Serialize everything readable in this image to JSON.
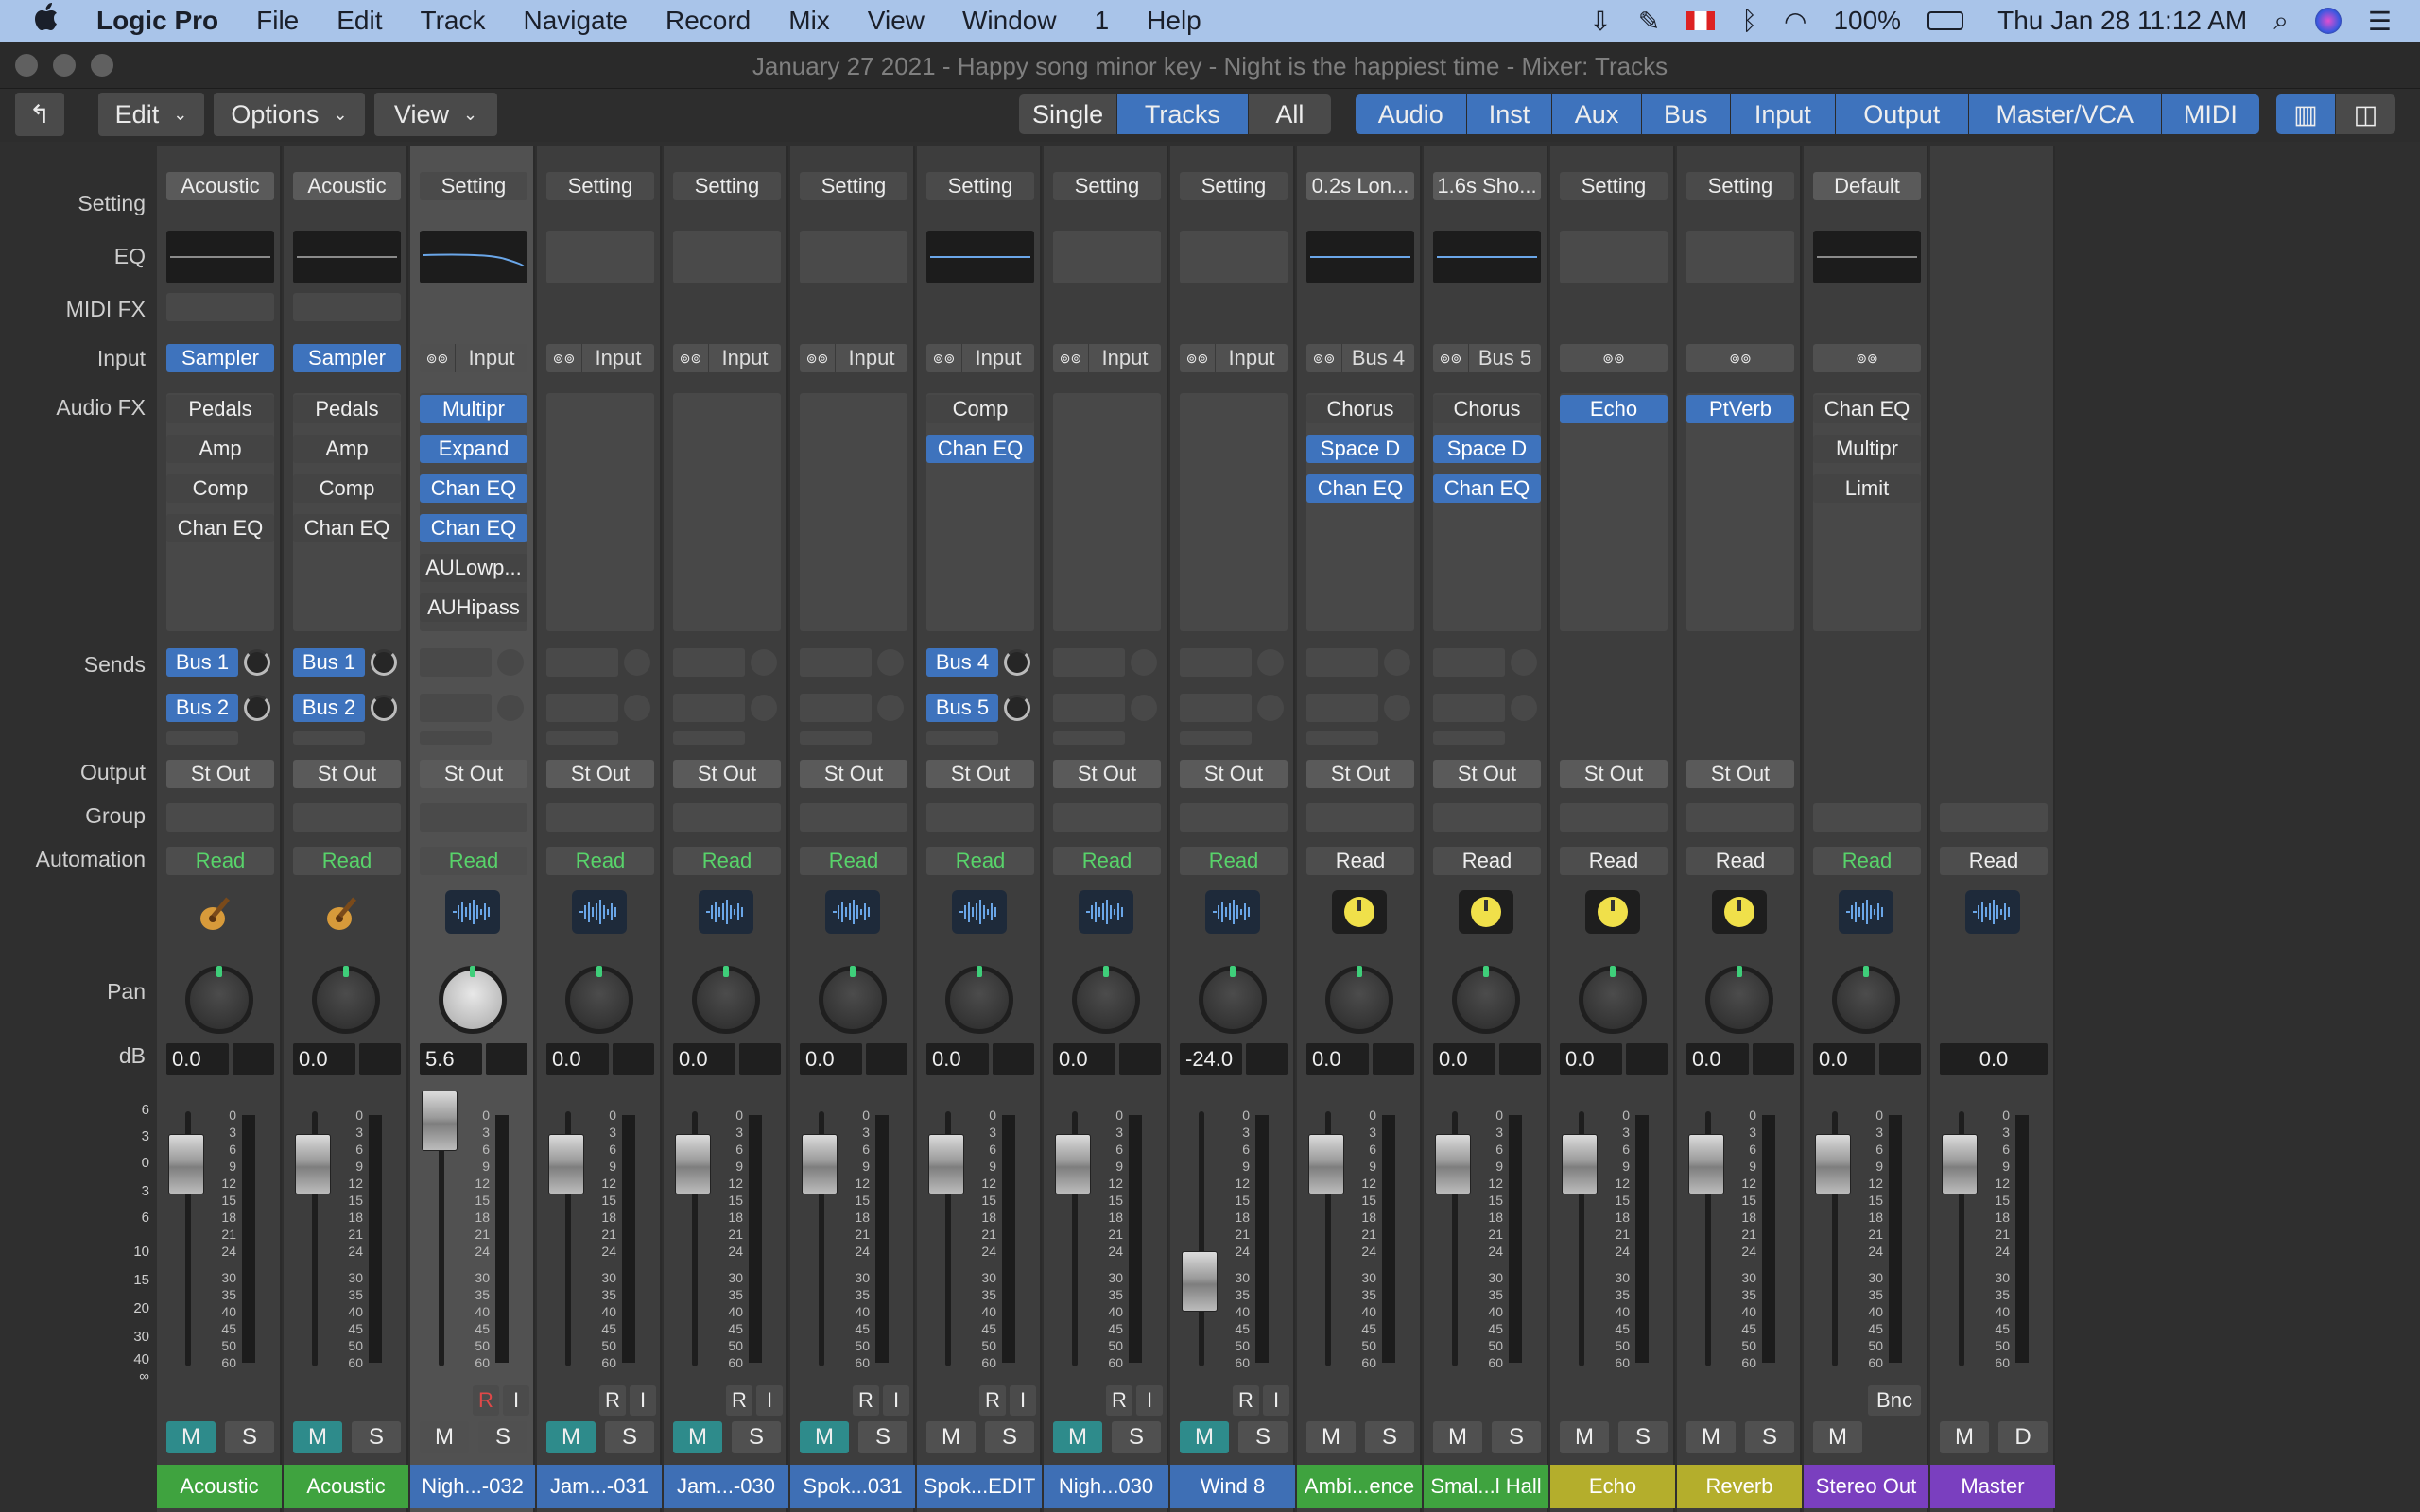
{
  "menubar": {
    "app": "Logic Pro",
    "items": [
      "File",
      "Edit",
      "Track",
      "Navigate",
      "Record",
      "Mix",
      "View",
      "Window",
      "1",
      "Help"
    ],
    "battery": "100%",
    "clock": "Thu Jan 28  11:12 AM"
  },
  "window": {
    "title": "January 27 2021 - Happy song minor key - Night is the happiest time - Mixer: Tracks"
  },
  "toolbar": {
    "edit": "Edit",
    "options": "Options",
    "view": "View",
    "filters": [
      "Single",
      "Tracks",
      "All"
    ],
    "filter_active": "Tracks",
    "types": [
      "Audio",
      "Inst",
      "Aux",
      "Bus",
      "Input",
      "Output",
      "Master/VCA",
      "MIDI"
    ]
  },
  "row_labels": {
    "setting": "Setting",
    "eq": "EQ",
    "midi_fx": "MIDI FX",
    "input": "Input",
    "audio_fx": "Audio FX",
    "sends": "Sends",
    "output": "Output",
    "group": "Group",
    "automation": "Automation",
    "pan": "Pan",
    "db": "dB"
  },
  "db_scale_left": [
    "6",
    "3",
    "0",
    "3",
    "6",
    "10",
    "15",
    "20",
    "30",
    "40",
    "∞"
  ],
  "db_scale_meter": [
    "0",
    "3",
    "6",
    "9",
    "12",
    "15",
    "18",
    "21",
    "24",
    "30",
    "35",
    "40",
    "45",
    "50",
    "60"
  ],
  "strips": [
    {
      "name": "Acoustic",
      "setting": "Acoustic",
      "input": "Sampler",
      "input_type": "inst",
      "fx": [
        "Pedals",
        "Amp",
        "Comp",
        "Chan EQ"
      ],
      "fx_on": [
        false,
        false,
        false,
        false
      ],
      "sends": [
        "Bus 1",
        "Bus 2"
      ],
      "output": "St Out",
      "auto": "Read",
      "auto_green": true,
      "icon": "guitar-icon",
      "db": "0.0",
      "mute": "M",
      "solo": "S",
      "mute_on": true,
      "color": "#3fa33f",
      "eq": "flat",
      "midifx": true
    },
    {
      "name": "Acoustic",
      "setting": "Acoustic",
      "input": "Sampler",
      "input_type": "inst",
      "fx": [
        "Pedals",
        "Amp",
        "Comp",
        "Chan EQ"
      ],
      "fx_on": [
        false,
        false,
        false,
        false
      ],
      "sends": [
        "Bus 1",
        "Bus 2"
      ],
      "output": "St Out",
      "auto": "Read",
      "auto_green": true,
      "icon": "guitar-icon",
      "db": "0.0",
      "mute": "M",
      "solo": "S",
      "mute_on": true,
      "color": "#3fa33f",
      "eq": "flat",
      "midifx": true
    },
    {
      "name": "Nigh...-032",
      "setting": "Setting",
      "input": "Input",
      "input_type": "audio",
      "fx": [
        "Multipr",
        "Expand",
        "Chan EQ",
        "Chan EQ",
        "AULowp...",
        "AUHipass"
      ],
      "fx_on": [
        true,
        true,
        true,
        true,
        false,
        false
      ],
      "sends": [],
      "output": "St Out",
      "auto": "Read",
      "auto_green": true,
      "icon": "waveform-icon",
      "db": "5.6",
      "mute": "M",
      "solo": "S",
      "mute_on": false,
      "color": "#3e6fb5",
      "eq": "curve",
      "selected": true,
      "rec": "R",
      "inmon": "I",
      "rec_red": true
    },
    {
      "name": "Jam...-031",
      "setting": "Setting",
      "input": "Input",
      "input_type": "audio",
      "fx": [],
      "fx_on": [],
      "sends": [],
      "output": "St Out",
      "auto": "Read",
      "auto_green": true,
      "icon": "waveform-icon",
      "db": "0.0",
      "mute": "M",
      "solo": "S",
      "mute_on": true,
      "color": "#3e6fb5",
      "eq": "none",
      "rec": "R",
      "inmon": "I"
    },
    {
      "name": "Jam...-030",
      "setting": "Setting",
      "input": "Input",
      "input_type": "audio",
      "fx": [],
      "fx_on": [],
      "sends": [],
      "output": "St Out",
      "auto": "Read",
      "auto_green": true,
      "icon": "waveform-icon",
      "db": "0.0",
      "mute": "M",
      "solo": "S",
      "mute_on": true,
      "color": "#3e6fb5",
      "eq": "none",
      "rec": "R",
      "inmon": "I"
    },
    {
      "name": "Spok...031",
      "setting": "Setting",
      "input": "Input",
      "input_type": "audio",
      "fx": [],
      "fx_on": [],
      "sends": [],
      "output": "St Out",
      "auto": "Read",
      "auto_green": true,
      "icon": "waveform-icon",
      "db": "0.0",
      "mute": "M",
      "solo": "S",
      "mute_on": true,
      "color": "#3e6fb5",
      "eq": "none",
      "rec": "R",
      "inmon": "I"
    },
    {
      "name": "Spok...EDIT",
      "setting": "Setting",
      "input": "Input",
      "input_type": "audio",
      "fx": [
        "Comp",
        "Chan EQ"
      ],
      "fx_on": [
        false,
        true
      ],
      "sends": [
        "Bus 4",
        "Bus 5"
      ],
      "output": "St Out",
      "auto": "Read",
      "auto_green": true,
      "icon": "waveform-icon",
      "db": "0.0",
      "mute": "M",
      "solo": "S",
      "mute_on": false,
      "color": "#3e6fb5",
      "eq": "line",
      "rec": "R",
      "inmon": "I"
    },
    {
      "name": "Nigh...030",
      "setting": "Setting",
      "input": "Input",
      "input_type": "audio",
      "fx": [],
      "fx_on": [],
      "sends": [],
      "output": "St Out",
      "auto": "Read",
      "auto_green": true,
      "icon": "waveform-icon",
      "db": "0.0",
      "mute": "M",
      "solo": "S",
      "mute_on": true,
      "color": "#3e6fb5",
      "eq": "none",
      "rec": "R",
      "inmon": "I"
    },
    {
      "name": "Wind 8",
      "setting": "Setting",
      "input": "Input",
      "input_type": "audio",
      "fx": [],
      "fx_on": [],
      "sends": [],
      "output": "St Out",
      "auto": "Read",
      "auto_green": true,
      "icon": "waveform-icon",
      "db": "-24.0",
      "mute": "M",
      "solo": "S",
      "mute_on": true,
      "color": "#3e6fb5",
      "eq": "none",
      "rec": "R",
      "inmon": "I"
    },
    {
      "name": "Ambi...ence",
      "setting": "0.2s Lon...",
      "input": "Bus 4",
      "input_type": "aux",
      "fx": [
        "Chorus",
        "Space D",
        "Chan EQ"
      ],
      "fx_on": [
        false,
        true,
        true
      ],
      "sends": [],
      "output": "St Out",
      "auto": "Read",
      "auto_green": false,
      "icon": "aux-knob-icon",
      "db": "0.0",
      "mute": "M",
      "solo": "S",
      "mute_on": false,
      "color": "#3fa33f",
      "eq": "line"
    },
    {
      "name": "Smal...l Hall",
      "setting": "1.6s Sho...",
      "input": "Bus 5",
      "input_type": "aux",
      "fx": [
        "Chorus",
        "Space D",
        "Chan EQ"
      ],
      "fx_on": [
        false,
        true,
        true
      ],
      "sends": [],
      "output": "St Out",
      "auto": "Read",
      "auto_green": false,
      "icon": "aux-knob-icon",
      "db": "0.0",
      "mute": "M",
      "solo": "S",
      "mute_on": false,
      "color": "#3fa33f",
      "eq": "line"
    },
    {
      "name": "Echo",
      "setting": "Setting",
      "input": "",
      "input_type": "aux",
      "fx": [
        "Echo"
      ],
      "fx_on": [
        true
      ],
      "sends": [],
      "nosends": true,
      "output": "St Out",
      "auto": "Read",
      "auto_green": false,
      "icon": "aux-knob-icon",
      "db": "0.0",
      "mute": "M",
      "solo": "S",
      "mute_on": false,
      "color": "#b4ae2c",
      "eq": "none"
    },
    {
      "name": "Reverb",
      "setting": "Setting",
      "input": "",
      "input_type": "aux",
      "fx": [
        "PtVerb"
      ],
      "fx_on": [
        true
      ],
      "sends": [],
      "nosends": true,
      "output": "St Out",
      "auto": "Read",
      "auto_green": false,
      "icon": "aux-knob-icon",
      "db": "0.0",
      "mute": "M",
      "solo": "S",
      "mute_on": false,
      "color": "#b4ae2c",
      "eq": "none"
    },
    {
      "name": "Stereo Out",
      "setting": "Default",
      "input": "",
      "input_type": "aux",
      "fx": [
        "Chan EQ",
        "Multipr",
        "Limit"
      ],
      "fx_on": [
        false,
        false,
        false
      ],
      "sends": [],
      "nosends": true,
      "output": "",
      "auto": "Read",
      "auto_green": true,
      "icon": "waveform-icon",
      "db": "0.0",
      "mute": "M",
      "solo": "",
      "bnc": "Bnc",
      "mute_on": false,
      "color": "#7a3fbf",
      "eq": "flat"
    },
    {
      "name": "Master",
      "setting": "",
      "input": "",
      "input_type": "none",
      "fx": [],
      "fx_on": [],
      "sends": [],
      "nosends": true,
      "output": "",
      "auto": "Read",
      "auto_green": false,
      "icon": "waveform-icon",
      "db": "0.0",
      "mute": "M",
      "solo": "D",
      "mute_on": false,
      "color": "#7a3fbf",
      "eq": "hidden",
      "master": true
    }
  ]
}
